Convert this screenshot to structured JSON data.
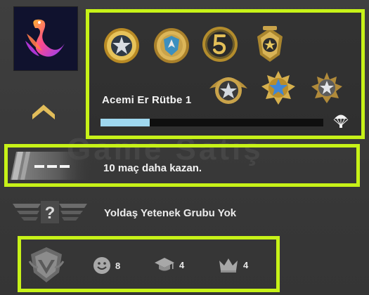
{
  "watermark": {
    "text": "Game Satış"
  },
  "rank": {
    "name": "Acemi Er Rütbe 1",
    "progress_fraction": 0.22
  },
  "medals": [
    {
      "icon": "silver-star-coin-medal"
    },
    {
      "icon": "gold-shield-coin-medal"
    },
    {
      "icon": "five-year-veteran-coin"
    },
    {
      "icon": "gold-crest-medal"
    },
    {
      "icon": "winged-silver-star-medal"
    },
    {
      "icon": "blue-star-gold-medal"
    },
    {
      "icon": "silver-star-badge-medal"
    }
  ],
  "wins": {
    "text": "10 maç daha kazan."
  },
  "skill_group": {
    "text": "Yoldaş Yetenek Grubu Yok"
  },
  "stats": {
    "friendly": {
      "icon": "smiley-icon",
      "value": "8"
    },
    "teacher": {
      "icon": "graduation-cap-icon",
      "value": "4"
    },
    "leader": {
      "icon": "crown-icon",
      "value": "4"
    }
  },
  "colors": {
    "highlight": "#c7f218",
    "xp_fill": "#9fd8ef",
    "chevron": "#e2bd5a"
  }
}
